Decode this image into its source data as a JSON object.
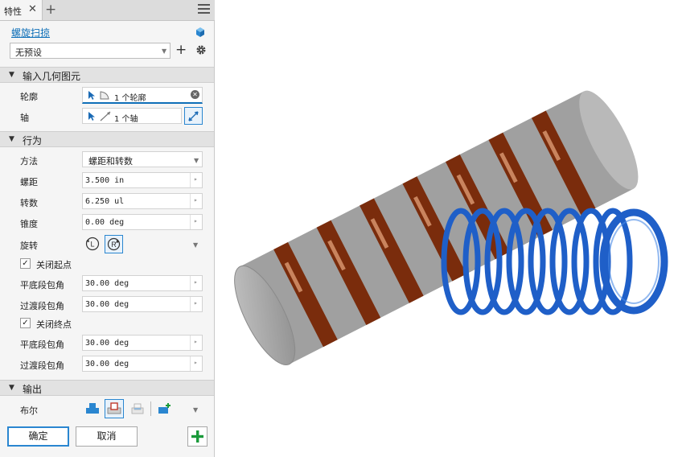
{
  "tab": {
    "label": "特性"
  },
  "feature_title": "螺旋扫掠",
  "preset": {
    "value": "无预设"
  },
  "sections": {
    "input": "输入几何图元",
    "behavior": "行为",
    "output": "输出"
  },
  "input": {
    "profile_label": "轮廓",
    "profile_value": "1 个轮廓",
    "axis_label": "轴",
    "axis_value": "1 个轴"
  },
  "behavior": {
    "method_label": "方法",
    "method_value": "螺距和转数",
    "pitch_label": "螺距",
    "pitch_value": "3.500 in",
    "revolutions_label": "转数",
    "revolutions_value": "6.250 ul",
    "taper_label": "锥度",
    "taper_value": "0.00 deg",
    "rotation_label": "旋转",
    "close_start_label": "关闭起点",
    "flat_start_label": "平底段包角",
    "flat_start_value": "30.00 deg",
    "transition_start_label": "过渡段包角",
    "transition_start_value": "30.00 deg",
    "close_end_label": "关闭终点",
    "flat_end_label": "平底段包角",
    "flat_end_value": "30.00 deg",
    "transition_end_label": "过渡段包角",
    "transition_end_value": "30.00 deg"
  },
  "output": {
    "boolean_label": "布尔"
  },
  "buttons": {
    "ok": "确定",
    "cancel": "取消"
  },
  "colors": {
    "accent": "#0e6fb8",
    "ok_green": "#1a9a3a",
    "spring_blue": "#1f5fc8",
    "copper": "#c0541c",
    "steel": "#b8b8b8"
  }
}
